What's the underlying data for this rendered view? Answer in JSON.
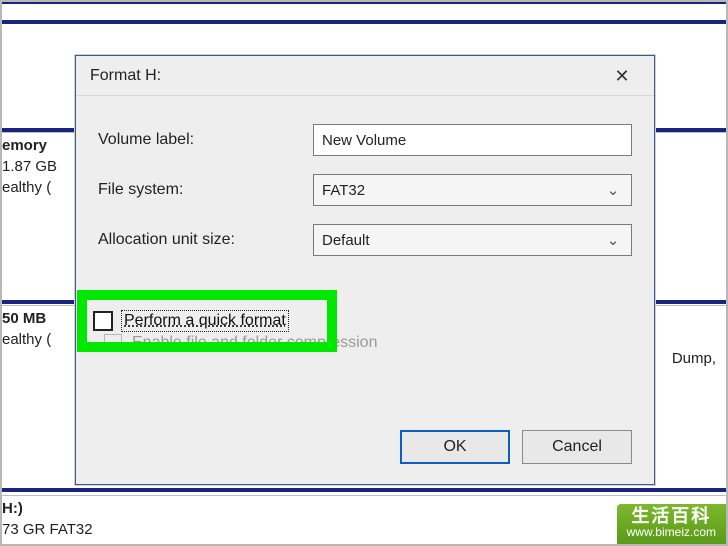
{
  "dialog": {
    "title": "Format H:",
    "close_symbol": "✕",
    "labels": {
      "volume_label": "Volume label:",
      "file_system": "File system:",
      "allocation_unit_size": "Allocation unit size:"
    },
    "values": {
      "volume_label": "New Volume",
      "file_system": "FAT32",
      "allocation_unit_size": "Default"
    },
    "checkboxes": {
      "quick_format": "Perform a quick format",
      "enable_compression": "Enable file and folder compression"
    },
    "buttons": {
      "ok": "OK",
      "cancel": "Cancel"
    }
  },
  "background": {
    "row1": {
      "title": "emory",
      "line2": "1.87 GB",
      "line3": "ealthy ("
    },
    "row2": {
      "title": "50 MB",
      "line2": "ealthy (",
      "right": "Dump,"
    },
    "row3": {
      "title": "H:)",
      "line2": "73 GR FAT32"
    }
  },
  "watermark": {
    "title": "生活百科",
    "url": "www.bimeiz.com"
  }
}
